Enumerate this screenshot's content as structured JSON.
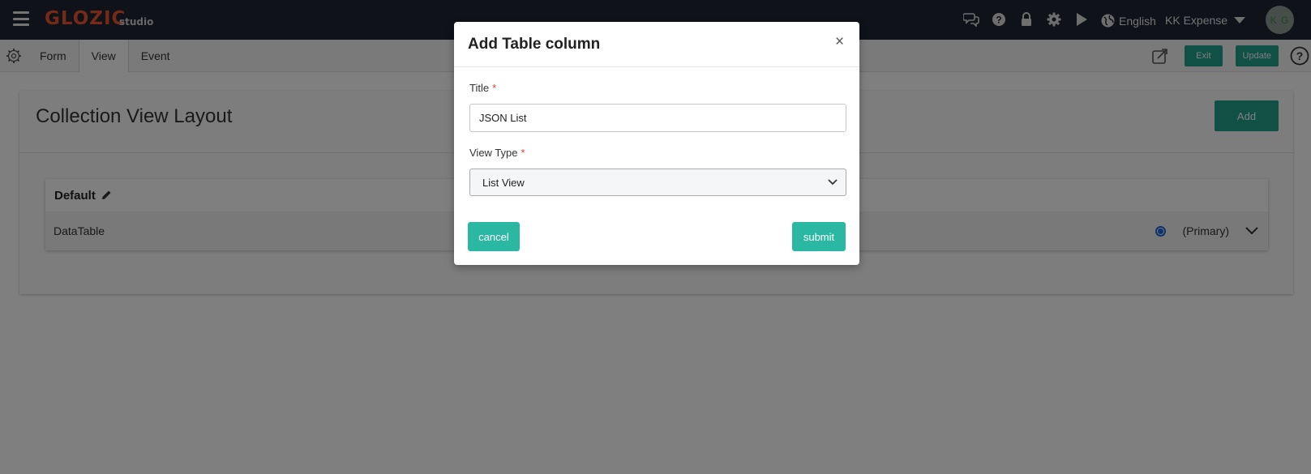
{
  "topbar": {
    "logo": "GLOZIC",
    "logo_sub": "studio",
    "icons": [
      "chat-icon",
      "help-icon",
      "lock-icon",
      "gear-icon",
      "play-icon"
    ],
    "language": "English",
    "workspace": "KK Expense",
    "avatar_initials": "K G"
  },
  "subbar": {
    "tabs": [
      {
        "label": "Form",
        "active": false
      },
      {
        "label": "View",
        "active": true
      },
      {
        "label": "Event",
        "active": false
      }
    ],
    "exit_label": "Exit",
    "update_label": "Update"
  },
  "panel": {
    "title": "Collection View Layout",
    "add_label": "Add",
    "card": {
      "title": "Default",
      "row_label": "DataTable",
      "row_primary": "(Primary)",
      "row_selected": true
    }
  },
  "modal": {
    "title": "Add Table column",
    "close_symbol": "×",
    "title_label": "Title",
    "title_value": "JSON List",
    "view_type_label": "View Type",
    "view_type_value": "List View",
    "required_mark": "*",
    "cancel_label": "cancel",
    "submit_label": "submit"
  },
  "colors": {
    "topbar_bg": "#1e2530",
    "logo": "#e8542e",
    "teal": "#22a08a",
    "modal_button": "#2bb8a3",
    "required": "#e53935",
    "radio": "#1a66d9"
  }
}
